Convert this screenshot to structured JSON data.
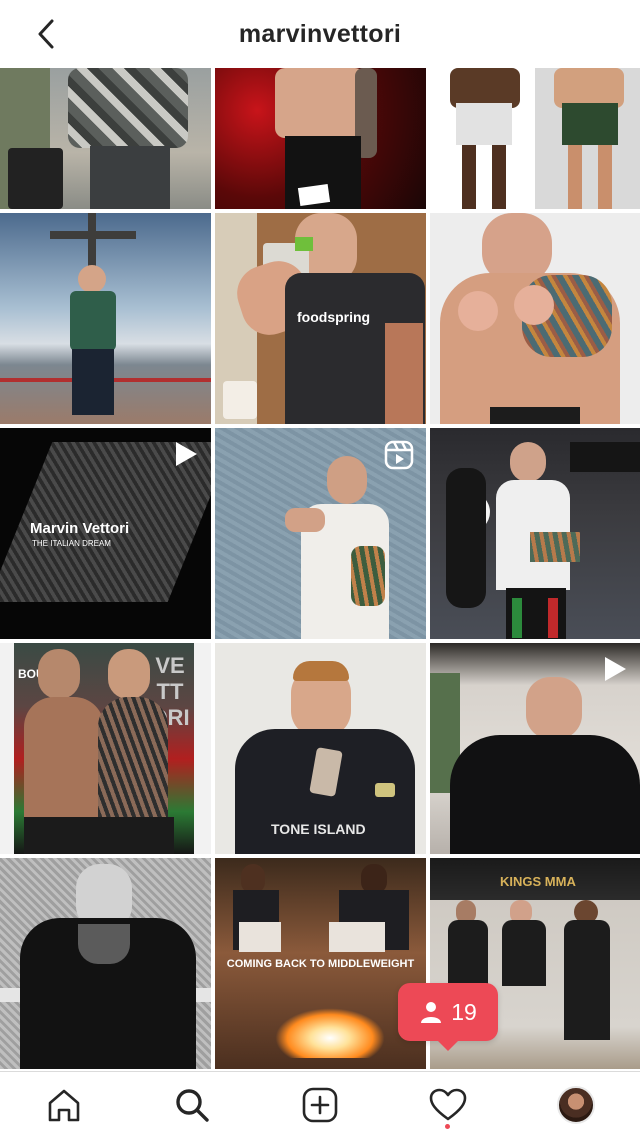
{
  "header": {
    "title": "marvinvettori"
  },
  "tiles": [
    {
      "name": "post-airport-suitcase"
    },
    {
      "name": "post-fighter-red-background"
    },
    {
      "name": "post-fighters-comparison"
    },
    {
      "name": "post-mountain-cross"
    },
    {
      "name": "post-foodspring-shake",
      "text": "foodspring"
    },
    {
      "name": "post-shirtless-fighter"
    },
    {
      "name": "post-marvin-vettori-video",
      "text_title": "Marvin Vettori",
      "text_sub": "THE ITALIAN DREAM"
    },
    {
      "name": "post-blue-wall-reel"
    },
    {
      "name": "post-training-gym"
    },
    {
      "name": "post-fight-poster",
      "text_left": "BOUT",
      "text_right": "VETTORI"
    },
    {
      "name": "post-eating-snack",
      "text": "TONE ISLAND"
    },
    {
      "name": "post-leather-jacket-video"
    },
    {
      "name": "post-black-white-portrait"
    },
    {
      "name": "post-middleweight-meme",
      "text": "COMING BACK TO MIDDLEWEIGHT"
    },
    {
      "name": "post-kings-mma-group",
      "text": "KINGS MMA"
    }
  ],
  "notification": {
    "count": "19"
  },
  "nav": {
    "items": [
      "home",
      "search",
      "create",
      "activity",
      "profile"
    ]
  }
}
